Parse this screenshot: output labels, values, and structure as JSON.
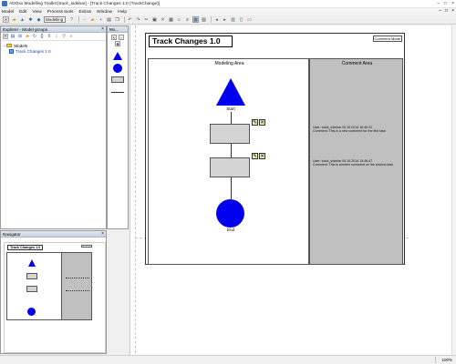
{
  "window": {
    "title": "ADOxx Modelling Toolkit [track_sidebar] - [Track Changes 1.0 (TrackChange)]",
    "controls": [
      "–",
      "□",
      "×"
    ]
  },
  "menubar": {
    "items": [
      "Model",
      "Edit",
      "View",
      "Process tools",
      "Extras",
      "Window",
      "Help"
    ],
    "mdi_controls": [
      "–",
      "□",
      "×"
    ]
  },
  "toolbar": {
    "mode_value": "Modelling"
  },
  "explorer": {
    "title": "Explorer - Model groups",
    "close": "×",
    "tree": {
      "group": "Models",
      "model": "Track Changes 1.0"
    }
  },
  "modelling_panel": {
    "title": "Mo..."
  },
  "navigator": {
    "title": "Navigator",
    "close": "×",
    "thumb_title": "Track Changes 1.0"
  },
  "diagram": {
    "title": "Track Changes 1.0",
    "comment_mode_label": "Comment Mode",
    "modeling_area_label": "Modeling Area",
    "comment_area_label": "Comment Area",
    "start_label": "Start",
    "end_label": "End",
    "comments": [
      {
        "meta": "User: track_sidebar  05.10.2014 15:46:22",
        "text": "Comment: This is a new comment for the first task"
      },
      {
        "meta": "User: track_sidebar  05.10.2014 15:46:47",
        "text": "Comment: This is another comment on the second task"
      }
    ],
    "colors": {
      "shape_fill": "#0000ee",
      "activity_fill": "#d4d4d4",
      "comment_area_fill": "#c0c0c0"
    }
  },
  "status": {
    "zoom": "100%"
  }
}
